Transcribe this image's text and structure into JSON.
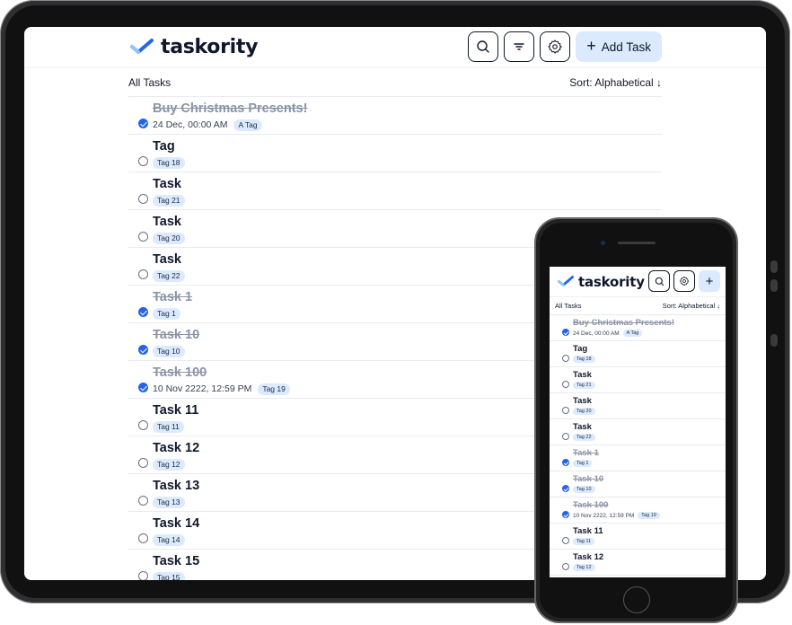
{
  "app": {
    "name": "taskority",
    "add_task_label": "Add Task",
    "add_symbol": "+",
    "accent_color": "#2563eb",
    "tag_color": "#dbeafe"
  },
  "toolbar": {
    "search_icon": "search-icon",
    "filter_icon": "filter-icon",
    "settings_icon": "gear-icon"
  },
  "list_header": {
    "title": "All Tasks",
    "sort": "Sort: Alphabetical ↓"
  },
  "tasks": [
    {
      "title": "Buy Christmas Presents!",
      "done": true,
      "date": "24 Dec, 00:00 AM",
      "tag": "A Tag"
    },
    {
      "title": "Tag",
      "done": false,
      "date": "",
      "tag": "Tag 18"
    },
    {
      "title": "Task",
      "done": false,
      "date": "",
      "tag": "Tag 21"
    },
    {
      "title": "Task",
      "done": false,
      "date": "",
      "tag": "Tag 20"
    },
    {
      "title": "Task",
      "done": false,
      "date": "",
      "tag": "Tag 22"
    },
    {
      "title": "Task 1",
      "done": true,
      "date": "",
      "tag": "Tag 1"
    },
    {
      "title": "Task 10",
      "done": true,
      "date": "",
      "tag": "Tag 10"
    },
    {
      "title": "Task 100",
      "done": true,
      "date": "10 Nov 2222, 12:59 PM",
      "tag": "Tag 19"
    },
    {
      "title": "Task 11",
      "done": false,
      "date": "",
      "tag": "Tag 11"
    },
    {
      "title": "Task 12",
      "done": false,
      "date": "",
      "tag": "Tag 12"
    },
    {
      "title": "Task 13",
      "done": false,
      "date": "",
      "tag": "Tag 13"
    },
    {
      "title": "Task 14",
      "done": false,
      "date": "",
      "tag": "Tag 14"
    },
    {
      "title": "Task 15",
      "done": false,
      "date": "",
      "tag": "Tag 15"
    }
  ]
}
